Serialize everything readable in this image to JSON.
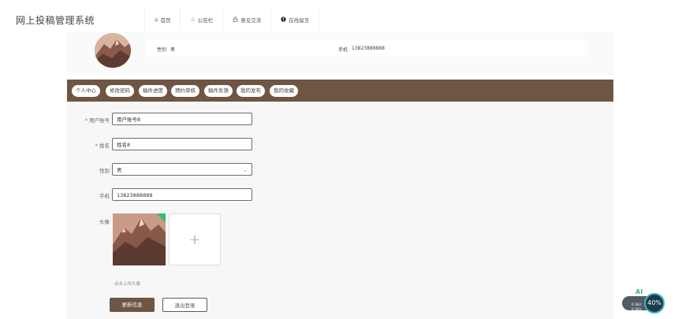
{
  "header": {
    "site_title": "网上投稿管理系统",
    "nav": [
      {
        "label": "首页",
        "icon": "home-icon"
      },
      {
        "label": "公告栏",
        "icon": "star-icon"
      },
      {
        "label": "意见交流",
        "icon": "lock-icon"
      },
      {
        "label": "在线留言",
        "icon": "info-icon"
      }
    ]
  },
  "profile": {
    "gender_label": "性别",
    "gender_value": "男",
    "phone_label": "手机",
    "phone_value": "13823888888"
  },
  "tabs": [
    "个人中心",
    "修改密码",
    "稿件进度",
    "预约审核",
    "稿件反馈",
    "我的发布",
    "我的收藏"
  ],
  "form": {
    "account_label": "用户账号",
    "account_value": "用户账号8",
    "name_label": "姓名",
    "name_value": "姓名8",
    "gender_label": "性别",
    "gender_value": "男",
    "phone_label": "手机",
    "phone_value": "13823888888",
    "avatar_label": "头像",
    "upload_hint": "点击上传头像",
    "update_button": "更新信息",
    "logout_button": "退出登录"
  },
  "widget": {
    "ai_label": "AI",
    "percent": "40%",
    "stat_1": "0.1K/s",
    "stat_2": "0.1K/s"
  },
  "colors": {
    "accent_brown": "#6f5544",
    "required_red": "#e0463c",
    "check_green": "#2fbf71"
  }
}
